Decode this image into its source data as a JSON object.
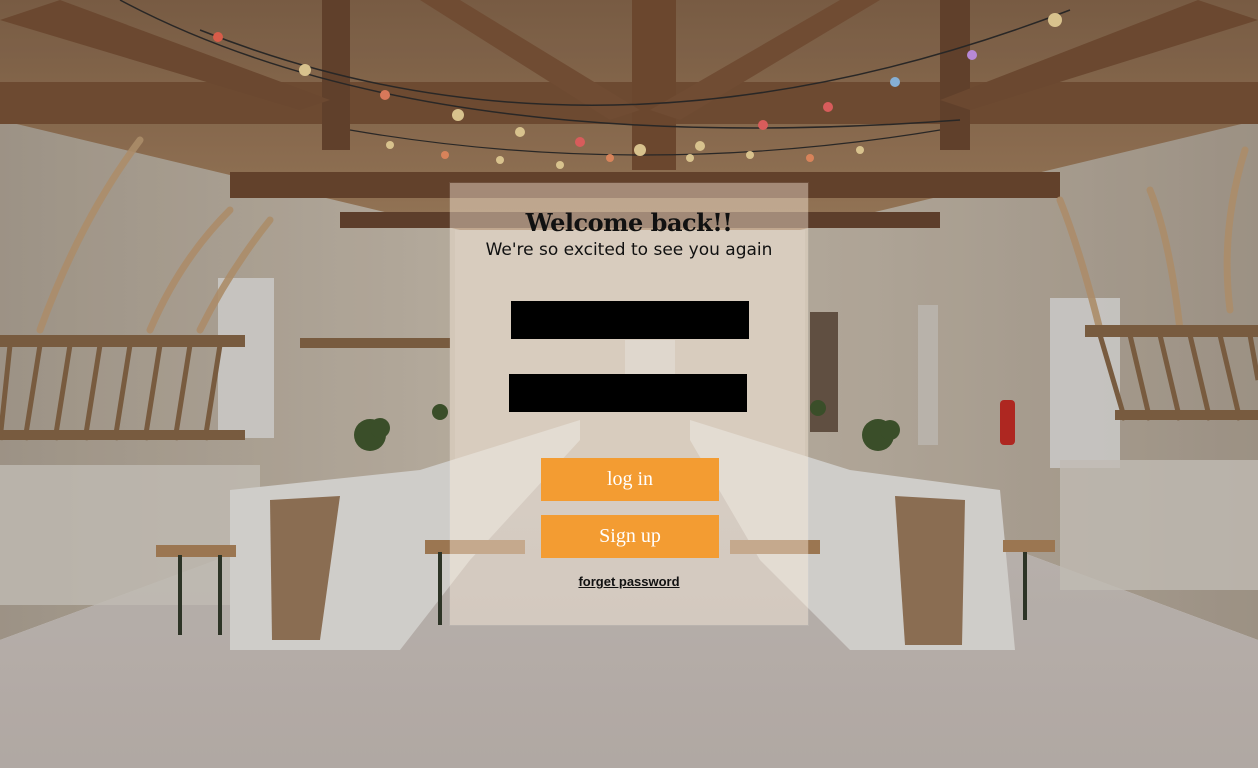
{
  "login": {
    "title": "Welcome back!!",
    "subtitle": "We're so excited to see you again",
    "username_field": {
      "value": "",
      "placeholder": ""
    },
    "password_field": {
      "value": "",
      "placeholder": ""
    },
    "login_button_label": "log in",
    "signup_button_label": "Sign up",
    "forgot_link_label": "forget password"
  },
  "colors": {
    "accent": "#f39c32",
    "field_fill": "#000000",
    "card_tint": "rgba(255,240,225,0.42)"
  }
}
